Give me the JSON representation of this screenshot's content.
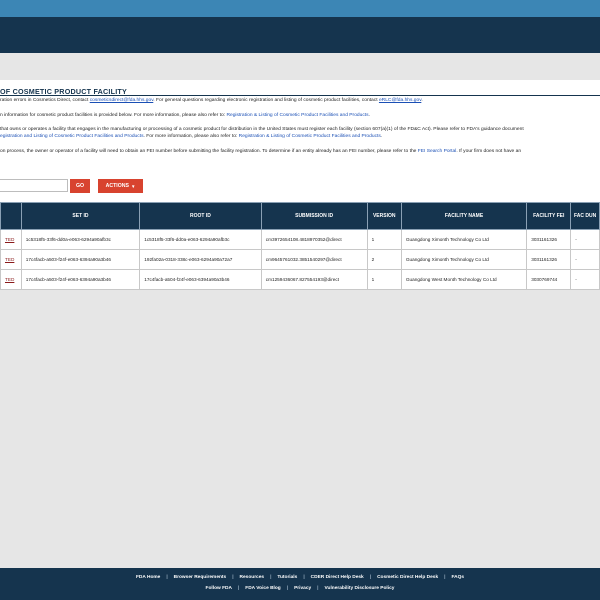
{
  "page": {
    "title": "OF COSMETIC PRODUCT FACILITY",
    "lines": [
      {
        "pre": "ration errors in Cosmetics Direct, contact ",
        "link1": "cosmeticsdirect@fda.hhs.gov",
        "mid": ". For general questions regarding electronic registration and listing of cosmetic product facilities, contact ",
        "link2": "eRLC@fda.hhs.gov",
        "post": "."
      },
      {
        "pre": "n information for cosmetic product facilities is provided below. For more information, please also refer to: ",
        "link": "Registration & Listing of Cosmetic Product Facilities and Products",
        "post": "."
      },
      {
        "pre": "that owns or operates a facility that engages in the manufacturing or processing of a cosmetic product for distribution in the United States must register each facility (section 607(a)(1) of the FD&C Act). Please refer to FDA's guidance document"
      },
      {
        "link": "egistration and Listing of Cosmetic Product Facilities and Products",
        "mid": ". For more information, please also refer to: ",
        "link2": "Registration & Listing of Cosmetic Product Facilities and Products",
        "post": "."
      },
      {
        "pre": "on process, the owner or operator of a facility will need to obtain an FEI number before submitting the facility registration. To determine if an entity already has an FEI number, please refer to the ",
        "link": "FEI Search Portal",
        "post": ". If your firm does not have an"
      }
    ]
  },
  "search": {
    "placeholder": ""
  },
  "buttons": {
    "go": "GO",
    "actions": "ACTIONS"
  },
  "table": {
    "headers": [
      "",
      "SET ID",
      "ROOT ID",
      "SUBMISSION ID",
      "VERSION",
      "FACILITY NAME",
      "FACILITY FEI",
      "FAC DUN"
    ],
    "rows": [
      {
        "status": "TED",
        "set_id": "1c5318f5-33f6-dd0a-e063-6294a90afb3c",
        "root_id": "1c5318f5-33f6-dd0a-e063-6294a90afb3c",
        "submission_id": "cm3972654108.4818970352@direct",
        "version": "1",
        "facility_name": "Guangdong Ximonth Technology Co Ltd",
        "fei": "3031161326",
        "duns": "-"
      },
      {
        "status": "TED",
        "set_id": "17c4facb-a503-f24f-e063-6394a90a3b46",
        "root_id": "192fa02a-0318-338c-e063-6294a90a72a7",
        "submission_id": "cm9645761032.3851540297@direct",
        "version": "2",
        "facility_name": "Guangdong Ximonth Technology Co Ltd",
        "fei": "3031161326",
        "duns": "-"
      },
      {
        "status": "TED",
        "set_id": "17c4facb-a503-f24f-e063-6394a90a3b46",
        "root_id": "17c4facb-a504-f24f-e063-6394a90a3b46",
        "submission_id": "cm1259436067.827554193@direct",
        "version": "1",
        "facility_name": "Guangdong West Month Technology Co Ltd",
        "fei": "3030769744",
        "duns": "-"
      }
    ]
  },
  "footer": {
    "row1": [
      "FDA Home",
      "Browser Requirements",
      "Resources",
      "Tutorials",
      "CDER Direct Help Desk",
      "Cosmetic Direct Help Desk",
      "FAQs"
    ],
    "row2": [
      "Follow FDA",
      "FDA Voice Blog",
      "Privacy",
      "Vulnerability Disclosure Policy"
    ]
  },
  "colors": {
    "header": "#15344e",
    "top_strip": "#3c86b5",
    "accent_button": "#d8432f",
    "link": "#1a4fb5"
  }
}
